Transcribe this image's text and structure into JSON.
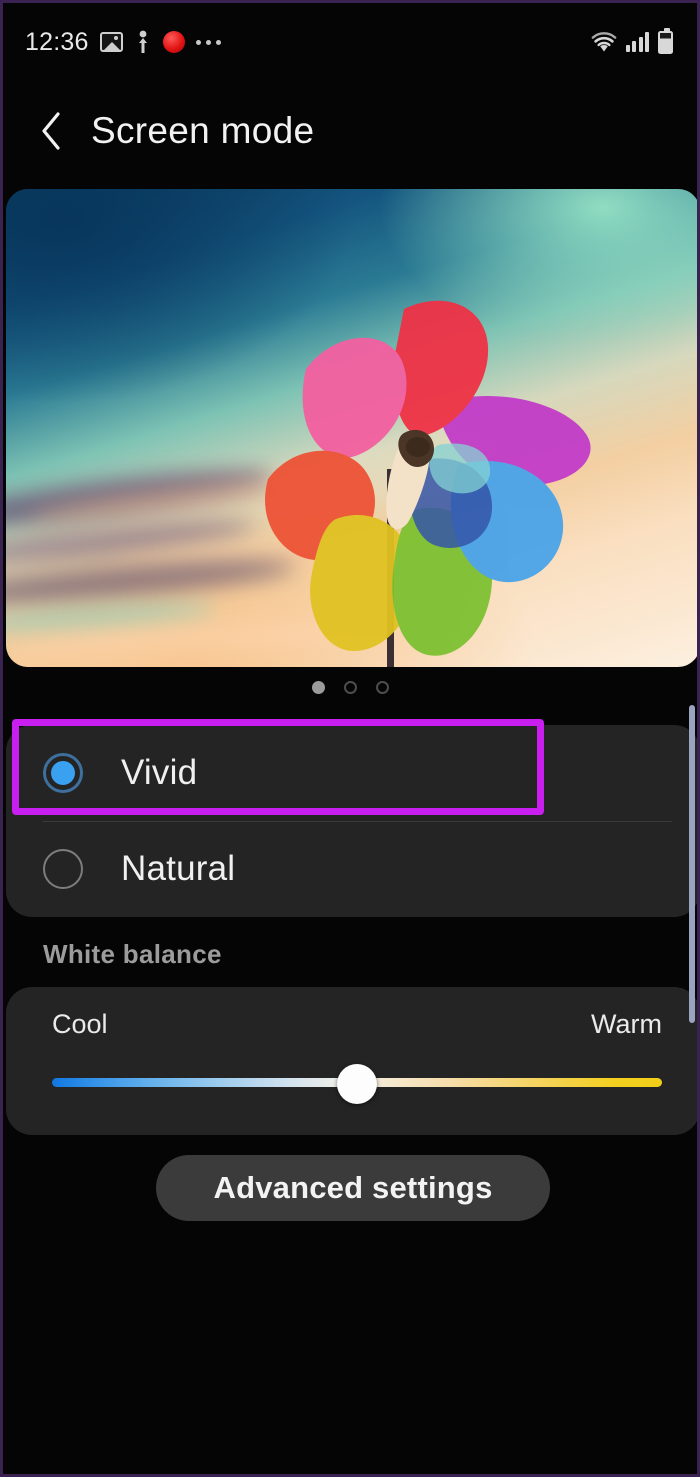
{
  "status_bar": {
    "clock": "12:36",
    "left_icons": [
      "gallery-icon",
      "person-icon",
      "red-alert-icon",
      "more-dots-icon"
    ],
    "right_icons": [
      "wifi-icon",
      "signal-icon",
      "battery-icon"
    ]
  },
  "header": {
    "back_icon": "back-chevron-icon",
    "title": "Screen mode"
  },
  "preview": {
    "alt": "colorful pinwheel against sunset sky",
    "page_dots": [
      {
        "active": true
      },
      {
        "active": false
      },
      {
        "active": false
      }
    ],
    "active_index": 0
  },
  "screen_modes": {
    "options": [
      {
        "label": "Vivid",
        "selected": true,
        "highlighted": true
      },
      {
        "label": "Natural",
        "selected": false,
        "highlighted": false
      }
    ]
  },
  "white_balance": {
    "section_label": "White balance",
    "cool_label": "Cool",
    "warm_label": "Warm",
    "slider_value_percent": 50
  },
  "footer": {
    "advanced_settings_label": "Advanced settings"
  },
  "colors": {
    "accent_blue": "#3aa0f0",
    "highlight_magenta": "#c91ef0",
    "card_bg": "#242424",
    "page_bg": "#050505",
    "text_primary": "#f0f0f0",
    "text_secondary": "#9c9c9c",
    "slider_cool": "#1177e0",
    "slider_warm": "#f1cf18",
    "page_border": "#3a2350"
  }
}
